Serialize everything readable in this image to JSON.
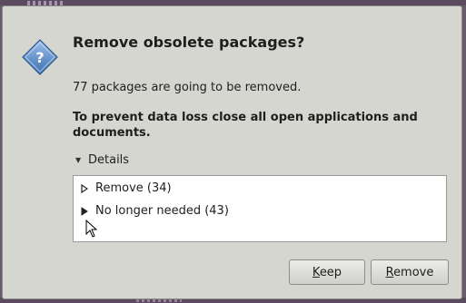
{
  "dialog": {
    "title": "Remove obsolete packages?",
    "message": "77 packages are going to be removed.",
    "warning": "To prevent data loss close all open applications and documents.",
    "icon": "question-diamond-icon",
    "details": {
      "label": "Details",
      "expanded": true,
      "items": [
        {
          "label": "Remove (34)",
          "expanded": false
        },
        {
          "label": "No longer needed (43)",
          "expanded": false
        }
      ]
    },
    "buttons": {
      "keep": {
        "mnemonic": "K",
        "rest": "eep"
      },
      "remove": {
        "mnemonic": "R",
        "rest": "emove"
      }
    }
  },
  "colors": {
    "dialog_bg": "#d6d6d1",
    "icon_blue": "#4a7fc1",
    "desktop": "#6a5a6e"
  }
}
